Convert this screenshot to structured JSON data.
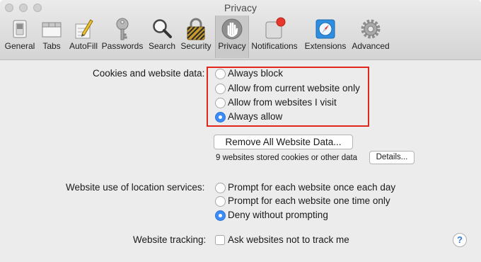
{
  "window": {
    "title": "Privacy"
  },
  "toolbar": {
    "items": [
      {
        "label": "General",
        "icon": "general-switch-icon"
      },
      {
        "label": "Tabs",
        "icon": "tabs-icon"
      },
      {
        "label": "AutoFill",
        "icon": "autofill-pencil-icon"
      },
      {
        "label": "Passwords",
        "icon": "key-icon"
      },
      {
        "label": "Search",
        "icon": "magnifier-icon"
      },
      {
        "label": "Security",
        "icon": "padlock-icon"
      },
      {
        "label": "Privacy",
        "icon": "hand-icon",
        "selected": true
      },
      {
        "label": "Notifications",
        "icon": "notifications-icon"
      },
      {
        "label": "Extensions",
        "icon": "compass-icon"
      },
      {
        "label": "Advanced",
        "icon": "gear-icon"
      }
    ]
  },
  "cookies": {
    "label": "Cookies and website data:",
    "options": [
      {
        "label": "Always block",
        "selected": false
      },
      {
        "label": "Allow from current website only",
        "selected": false
      },
      {
        "label": "Allow from websites I visit",
        "selected": false
      },
      {
        "label": "Always allow",
        "selected": true
      }
    ],
    "remove_button": "Remove All Website Data...",
    "stored_info": "9 websites stored cookies or other data",
    "details_button": "Details..."
  },
  "location": {
    "label": "Website use of location services:",
    "options": [
      {
        "label": "Prompt for each website once each day",
        "selected": false
      },
      {
        "label": "Prompt for each website one time only",
        "selected": false
      },
      {
        "label": "Deny without prompting",
        "selected": true
      }
    ]
  },
  "tracking": {
    "label": "Website tracking:",
    "checkbox_label": "Ask websites not to track me",
    "checked": false
  },
  "help": {
    "label": "?"
  },
  "colors": {
    "accent": "#3b8cf6",
    "highlight_box": "#e0261d",
    "badge": "#e8372c"
  }
}
